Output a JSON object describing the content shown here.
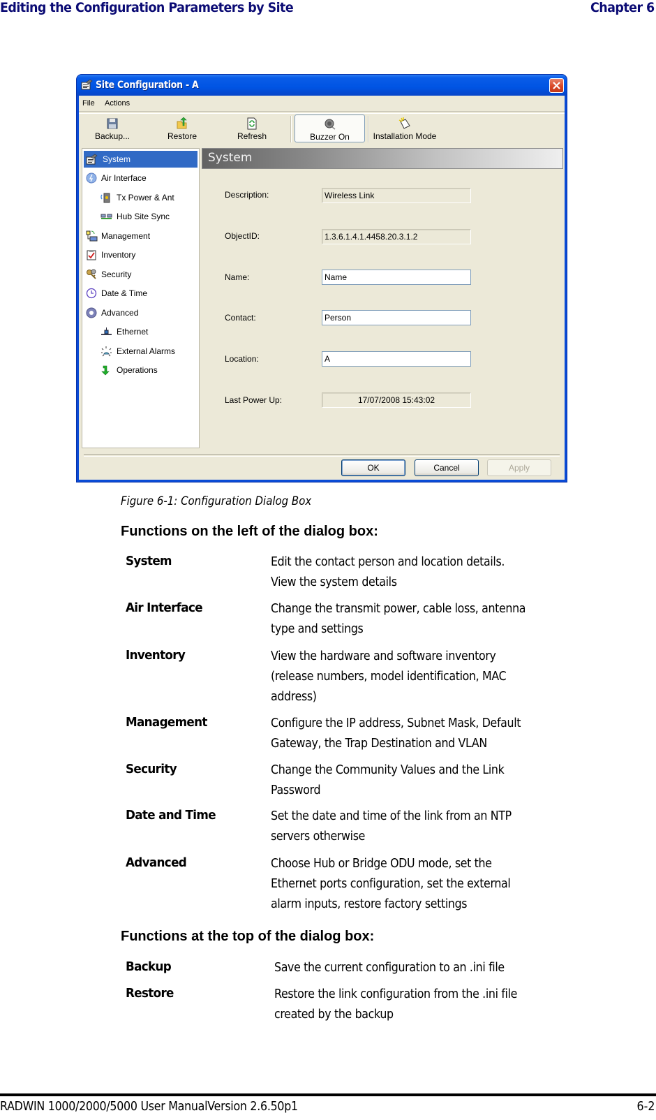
{
  "page_header": {
    "title": "Editing the Configuration Parameters by Site",
    "chapter": "Chapter 6"
  },
  "dialog": {
    "title": "Site Configuration - A",
    "menu": [
      "File",
      "Actions"
    ],
    "toolbar": [
      {
        "label": "Backup...",
        "icon": "floppy-disk-icon"
      },
      {
        "label": "Restore",
        "icon": "restore-folder-icon"
      },
      {
        "label": "Refresh",
        "icon": "refresh-document-icon"
      },
      {
        "label": "Buzzer On",
        "icon": "speaker-icon",
        "active": true
      },
      {
        "label": "Installation Mode",
        "icon": "installation-mode-icon"
      }
    ],
    "tree": [
      {
        "label": "System",
        "icon": "system-icon",
        "level": 0,
        "selected": true
      },
      {
        "label": "Air Interface",
        "icon": "globe-icon",
        "level": 0
      },
      {
        "label": "Tx Power & Ant",
        "icon": "antenna-icon",
        "level": 1
      },
      {
        "label": "Hub Site Sync",
        "icon": "sync-icon",
        "level": 1
      },
      {
        "label": "Management",
        "icon": "network-management-icon",
        "level": 0
      },
      {
        "label": "Inventory",
        "icon": "clipboard-check-icon",
        "level": 0
      },
      {
        "label": "Security",
        "icon": "keys-icon",
        "level": 0
      },
      {
        "label": "Date & Time",
        "icon": "clock-icon",
        "level": 0
      },
      {
        "label": "Advanced",
        "icon": "gear-icon",
        "level": 0
      },
      {
        "label": "Ethernet",
        "icon": "ethernet-icon",
        "level": 1
      },
      {
        "label": "External Alarms",
        "icon": "alarm-light-icon",
        "level": 1
      },
      {
        "label": "Operations",
        "icon": "green-arrow-down-icon",
        "level": 1
      }
    ],
    "pane_title": "System",
    "fields": [
      {
        "label": "Description:",
        "value": "Wireless Link",
        "editable": false
      },
      {
        "label": "ObjectID:",
        "value": "1.3.6.1.4.1.4458.20.3.1.2",
        "editable": false
      },
      {
        "label": "Name:",
        "value": "Name",
        "editable": true
      },
      {
        "label": "Contact:",
        "value": "Person",
        "editable": true
      },
      {
        "label": "Location:",
        "value": "A",
        "editable": true
      },
      {
        "label": "Last Power Up:",
        "value": "17/07/2008 15:43:02",
        "editable": false
      }
    ],
    "buttons": {
      "ok": "OK",
      "cancel": "Cancel",
      "apply": "Apply"
    }
  },
  "caption": "Figure 6-1: Configuration Dialog Box",
  "left_functions": {
    "heading": "Functions on the left of the dialog box:",
    "items": [
      {
        "term": "System",
        "desc": [
          "Edit the contact person and location details.",
          "View the system details"
        ]
      },
      {
        "term": "Air Interface",
        "desc": [
          "Change the transmit power, cable loss, antenna",
          "type and settings"
        ]
      },
      {
        "term": "Inventory",
        "desc": [
          "View the hardware and software inventory",
          "(release numbers, model identification, MAC",
          "address)"
        ]
      },
      {
        "term": "Management",
        "desc": [
          "Configure the IP address, Subnet Mask, Default",
          "Gateway, the Trap Destination and VLAN"
        ]
      },
      {
        "term": "Security",
        "desc": [
          "Change the Community Values and the Link",
          "Password"
        ]
      },
      {
        "term": "Date and Time",
        "desc": [
          "Set the date and time of the link from an NTP",
          "servers otherwise"
        ]
      },
      {
        "term": "Advanced",
        "desc": [
          "Choose Hub or Bridge ODU mode, set the",
          "Ethernet ports configuration, set the external",
          "alarm inputs, restore factory settings"
        ]
      }
    ]
  },
  "top_functions": {
    "heading": "Functions at the top of the dialog box:",
    "items": [
      {
        "term": "Backup",
        "desc": [
          "Save the current configuration to an .ini file"
        ]
      },
      {
        "term": "Restore",
        "desc": [
          "Restore the link configuration from the .ini file",
          "created by the backup"
        ]
      }
    ]
  },
  "footer": {
    "left": "RADWIN 1000/2000/5000 User ManualVersion  2.6.50p1",
    "right": "6-2"
  }
}
